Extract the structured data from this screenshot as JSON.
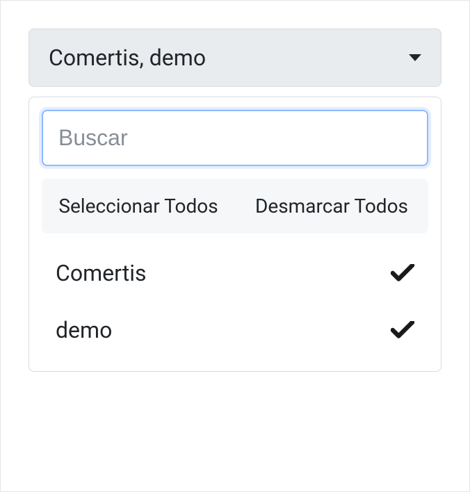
{
  "select": {
    "displayValue": "Comertis, demo"
  },
  "search": {
    "placeholder": "Buscar",
    "value": ""
  },
  "bulkActions": {
    "selectAll": "Seleccionar Todos",
    "deselectAll": "Desmarcar Todos"
  },
  "options": [
    {
      "label": "Comertis",
      "selected": true
    },
    {
      "label": "demo",
      "selected": true
    }
  ]
}
